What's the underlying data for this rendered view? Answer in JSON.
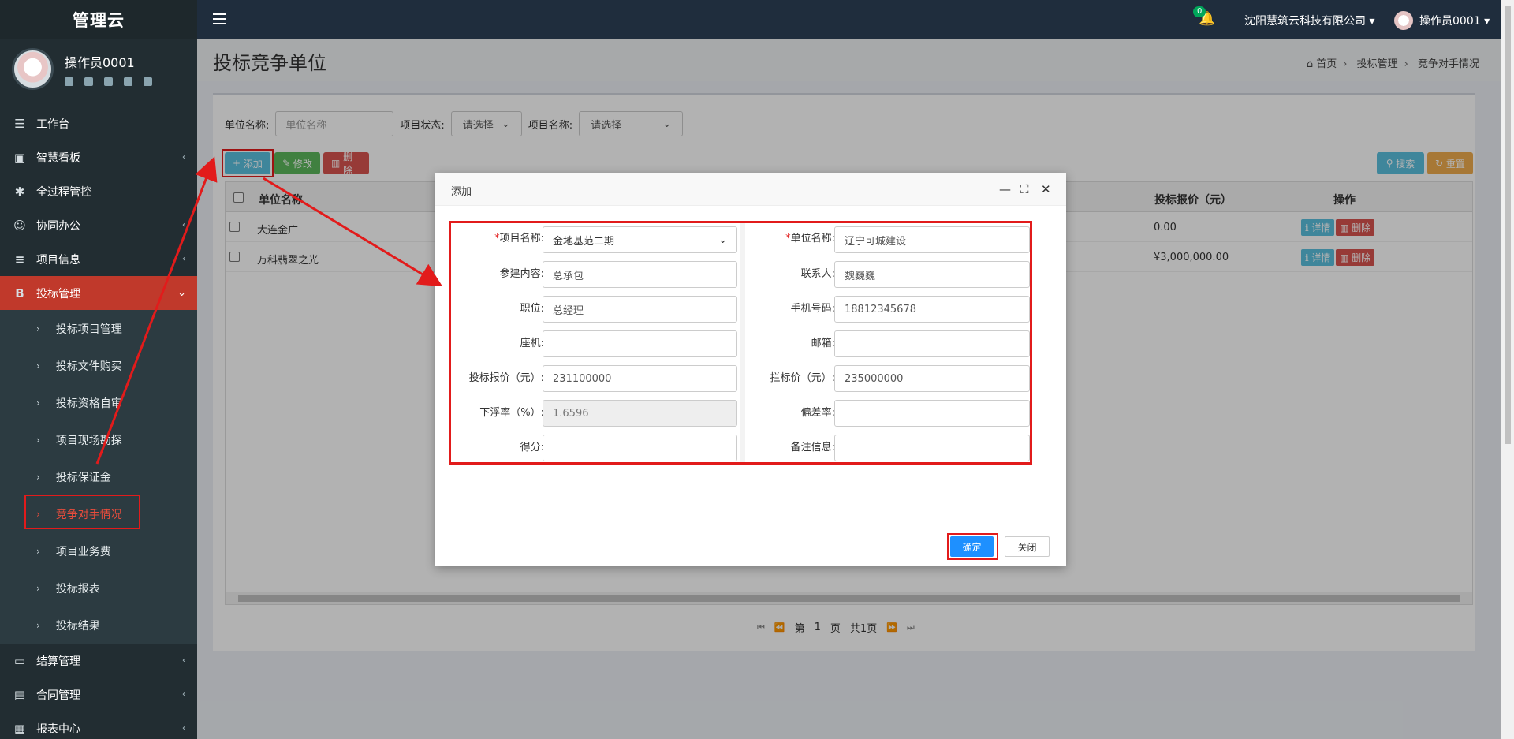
{
  "app": {
    "brand": "管理云"
  },
  "user": {
    "name": "操作员0001"
  },
  "header": {
    "notification_count": "0",
    "company": "沈阳慧筑云科技有限公司",
    "user_menu": "操作员0001"
  },
  "nav": {
    "items": [
      {
        "label": "工作台",
        "icon": "desktop-icon"
      },
      {
        "label": "智慧看板",
        "icon": "dashboard-icon"
      },
      {
        "label": "全过程管控",
        "icon": "asterisk-icon"
      },
      {
        "label": "协同办公",
        "icon": "users-icon"
      },
      {
        "label": "项目信息",
        "icon": "list-icon"
      },
      {
        "label": "投标管理",
        "icon": "bitcoin-icon"
      },
      {
        "label": "结算管理",
        "icon": "monitor-icon"
      },
      {
        "label": "合同管理",
        "icon": "file-icon"
      },
      {
        "label": "报表中心",
        "icon": "table-icon"
      }
    ],
    "sub_items": [
      "投标项目管理",
      "投标文件购买",
      "投标资格自审",
      "项目现场勘探",
      "投标保证金",
      "竞争对手情况",
      "项目业务费",
      "投标报表",
      "投标结果"
    ]
  },
  "page": {
    "title": "投标竞争单位",
    "breadcrumb": [
      "首页",
      "投标管理",
      "竞争对手情况"
    ]
  },
  "filters": {
    "unit_label": "单位名称:",
    "unit_placeholder": "单位名称",
    "status_label": "项目状态:",
    "status_value": "请选择",
    "project_label": "项目名称:",
    "project_value": "请选择"
  },
  "toolbar": {
    "add": "添加",
    "edit": "修改",
    "delete": "删除",
    "search": "搜索",
    "reset": "重置"
  },
  "table": {
    "headers": {
      "unit": "单位名称",
      "price": "投标报价（元）",
      "ops": "操作"
    },
    "rows": [
      {
        "unit": "大连金广",
        "price": "0.00"
      },
      {
        "unit": "万科翡翠之光",
        "price": "¥3,000,000.00"
      }
    ],
    "row_actions": {
      "detail": "详情",
      "delete": "删除"
    }
  },
  "pager": {
    "page_prefix": "第",
    "page_num": "1",
    "page_suffix": "页",
    "total": "共1页"
  },
  "modal": {
    "title": "添加",
    "fields": {
      "project_name": {
        "label": "项目名称:",
        "value": "金地基范二期"
      },
      "unit_name": {
        "label": "单位名称:",
        "value": "辽宁可城建设"
      },
      "content": {
        "label": "参建内容:",
        "value": "总承包"
      },
      "contact": {
        "label": "联系人:",
        "value": "魏巍巍"
      },
      "position": {
        "label": "职位:",
        "value": "总经理"
      },
      "phone": {
        "label": "手机号码:",
        "value": "18812345678"
      },
      "landline": {
        "label": "座机:",
        "value": ""
      },
      "email": {
        "label": "邮箱:",
        "value": ""
      },
      "bid_price": {
        "label": "投标报价（元）:",
        "value": "231100000"
      },
      "control_price": {
        "label": "拦标价（元）:",
        "value": "235000000"
      },
      "float_rate": {
        "label": "下浮率（%）:",
        "value": "1.6596"
      },
      "deviation": {
        "label": "偏差率:",
        "value": ""
      },
      "score": {
        "label": "得分:",
        "value": ""
      },
      "remark": {
        "label": "备注信息:",
        "value": ""
      }
    },
    "ok": "确定",
    "close": "关闭"
  },
  "colors": {
    "sidebar": "#222d32",
    "active_nav": "#c0392b",
    "annotation_red": "#e21b1b",
    "primary": "#1e90ff"
  }
}
